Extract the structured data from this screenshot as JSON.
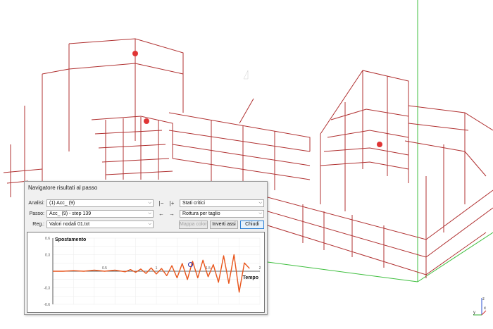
{
  "panel": {
    "title": "Navigatore risultati al passo",
    "analisi_label": "Analisi:",
    "analisi_value": "(1) Acc_ (9)",
    "passo_label": "Passo:",
    "passo_value": "Acc_ (9) - step 139",
    "reg_label": "Reg.:",
    "reg_value": "Valori nodali 01.txt",
    "state_value": "Stati critici",
    "mode_value": "Rottura per taglio",
    "first_step_icon": "first-step-icon",
    "last_step_icon": "last-step-icon",
    "prev_icon": "arrow-left-icon",
    "next_icon": "arrow-right-icon",
    "buttons": {
      "mappa": "Mappa colori",
      "inverti": "Inverti assi",
      "chiudi": "Chiudi"
    }
  },
  "chart_data": {
    "type": "line",
    "ylabel": "Spostamento",
    "xlabel": "Tempo",
    "xlim": [
      0,
      2
    ],
    "ylim": [
      -0.6,
      0.6
    ],
    "x_ticks": [
      "0.5",
      "1",
      "1.5",
      "2"
    ],
    "y_ticks": [
      "0.6",
      "0.3",
      "-0.3",
      "-0.6"
    ],
    "grid": true,
    "series": [
      {
        "color": "#e8541a",
        "x": [
          0,
          0.1,
          0.2,
          0.3,
          0.4,
          0.5,
          0.6,
          0.7,
          0.75,
          0.8,
          0.85,
          0.9,
          0.95,
          1.0,
          1.05,
          1.1,
          1.15,
          1.2,
          1.25,
          1.3,
          1.35,
          1.4,
          1.45,
          1.5,
          1.55,
          1.6,
          1.65,
          1.7,
          1.75,
          1.8,
          1.85,
          1.9
        ],
        "y": [
          0,
          0,
          0.01,
          0,
          0.02,
          0,
          0.02,
          -0.01,
          0.03,
          -0.02,
          0.04,
          -0.04,
          0.06,
          -0.05,
          0.05,
          -0.08,
          0.1,
          -0.12,
          0.14,
          -0.15,
          0.18,
          -0.12,
          0.2,
          -0.1,
          0.12,
          -0.2,
          0.28,
          -0.22,
          0.3,
          -0.38,
          0.15,
          0.05
        ]
      }
    ],
    "marker": {
      "x": 1.33,
      "y": 0.12,
      "color": "#2a2aa8"
    }
  },
  "axes_triad": {
    "x_label": "x",
    "y_label": "y",
    "z_label": "z"
  },
  "colors": {
    "frame": "#b03030",
    "node": "#e03535",
    "ground": "#3fbf3f"
  }
}
